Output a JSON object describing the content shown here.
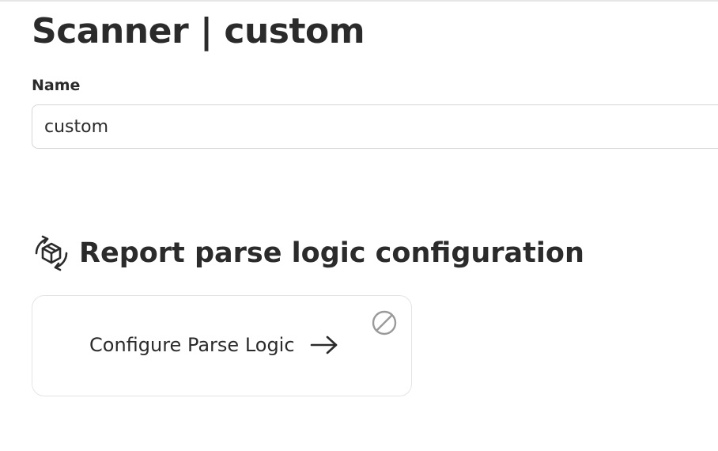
{
  "page": {
    "title": "Scanner | custom"
  },
  "form": {
    "name_label": "Name",
    "name_value": "custom"
  },
  "section": {
    "title": "Report parse logic configuration",
    "icon": "rotating-box-icon"
  },
  "card": {
    "link_label": "Configure Parse Logic",
    "arrow_icon": "arrow-right-icon",
    "status_icon": "disabled-icon"
  },
  "colors": {
    "text": "#2b2b2b",
    "border": "#d6d6d6",
    "muted_icon": "#9a9a9a"
  }
}
